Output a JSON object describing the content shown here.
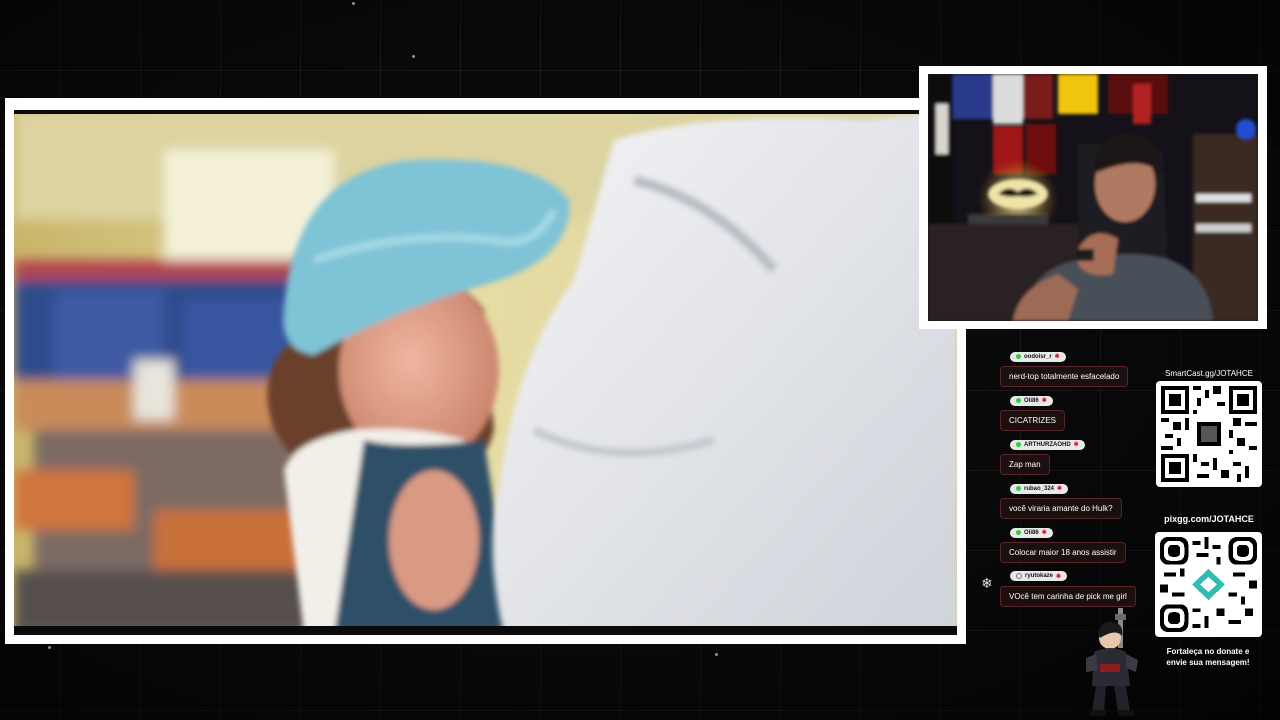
{
  "overlay": {
    "chat_icon": "snowflake-icon",
    "smartcast": {
      "label": "SmartCast.gg/JOTAHCE"
    },
    "pix": {
      "label": "pixgg.com/JOTAHCE",
      "cta_line1": "Fortaleça no donate e",
      "cta_line2": "envie sua mensagem!"
    }
  },
  "chat": {
    "messages": [
      {
        "user": "oodoisr_r",
        "badge": "green",
        "text": "nerd-top totalmente esfacelado"
      },
      {
        "user": "Oli86",
        "badge": "green",
        "text": "CICATRIZES"
      },
      {
        "user": "ARTHURZAOHD",
        "badge": "green",
        "text": "Zap man"
      },
      {
        "user": "rubao_324",
        "badge": "green",
        "text": "você viraria amante do Hulk?"
      },
      {
        "user": "Oli86",
        "badge": "green",
        "text": "Colocar maior 18 anos assistir"
      },
      {
        "user": "ryutokaze",
        "badge": "hollow",
        "text": "VOcê tem carinha de pick me girl"
      }
    ]
  },
  "colors": {
    "frame": "#ffffff",
    "bubble_bg": "#1c0f10",
    "bubble_border": "#5a2528",
    "badge_green": "#2ecc40",
    "background": "#0b0b0d"
  }
}
